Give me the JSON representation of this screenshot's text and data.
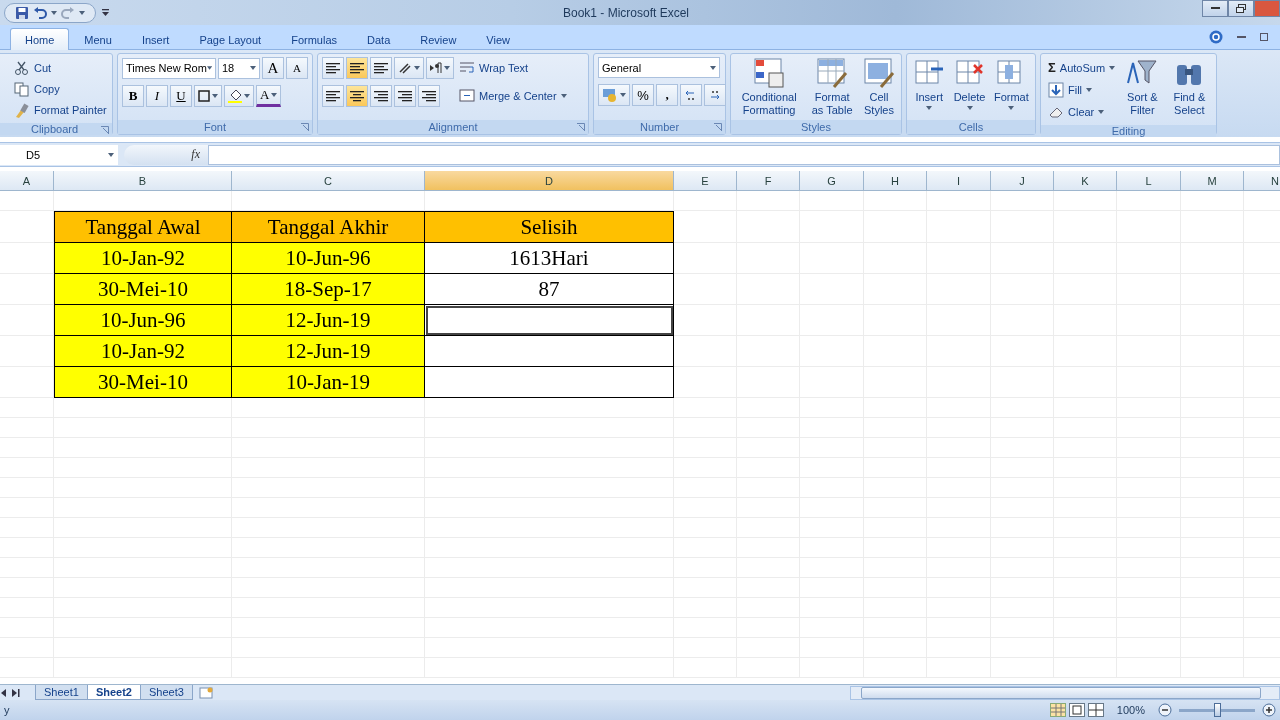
{
  "window": {
    "title": "Book1 - Microsoft Excel"
  },
  "tabs": [
    {
      "label": "Home",
      "selected": true
    },
    {
      "label": "Menu",
      "selected": false
    },
    {
      "label": "Insert",
      "selected": false
    },
    {
      "label": "Page Layout",
      "selected": false
    },
    {
      "label": "Formulas",
      "selected": false
    },
    {
      "label": "Data",
      "selected": false
    },
    {
      "label": "Review",
      "selected": false
    },
    {
      "label": "View",
      "selected": false
    }
  ],
  "ribbon": {
    "clipboard": {
      "items": [
        "Cut",
        "Copy",
        "Format Painter"
      ],
      "label": "Clipboard"
    },
    "font": {
      "font_name": "Times New Rom",
      "font_size": "18",
      "grow": "A",
      "shrink": "A",
      "bold": "B",
      "italic": "I",
      "underline": "U",
      "font_color": "A",
      "label": "Font"
    },
    "alignment": {
      "wrap": "Wrap Text",
      "merge": "Merge & Center",
      "label": "Alignment"
    },
    "number": {
      "format": "General",
      "percent": "%",
      "comma": ",",
      "label": "Number"
    },
    "styles": {
      "items": [
        "Conditional Formatting",
        "Format as Table",
        "Cell Styles"
      ],
      "label": "Styles"
    },
    "cells": {
      "items": [
        "Insert",
        "Delete",
        "Format"
      ],
      "label": "Cells"
    },
    "editing": {
      "sigma": "Σ",
      "autosum": "AutoSum",
      "fill": "Fill",
      "clear": "Clear",
      "big": [
        "Sort & Filter",
        "Find & Select"
      ],
      "label": "Editing"
    }
  },
  "formula_bar": {
    "name_box": "D5",
    "function_label": "fx"
  },
  "columns": [
    {
      "label": "A",
      "selected": false
    },
    {
      "label": "B",
      "selected": false
    },
    {
      "label": "C",
      "selected": false
    },
    {
      "label": "D",
      "selected": true
    },
    {
      "label": "E",
      "selected": false
    },
    {
      "label": "F",
      "selected": false
    },
    {
      "label": "G",
      "selected": false
    },
    {
      "label": "H",
      "selected": false
    },
    {
      "label": "I",
      "selected": false
    },
    {
      "label": "J",
      "selected": false
    },
    {
      "label": "K",
      "selected": false
    },
    {
      "label": "L",
      "selected": false
    },
    {
      "label": "M",
      "selected": false
    },
    {
      "label": "N",
      "selected": false
    }
  ],
  "table": {
    "header": [
      {
        "text": "Tanggal Awal",
        "color": "#ffc000"
      },
      {
        "text": "Tanggal Akhir",
        "color": "#ffc000"
      },
      {
        "text": "Selisih",
        "color": "#ffc000"
      }
    ],
    "rows": [
      [
        {
          "text": "10-Jan-92",
          "color": "#ffff00",
          "selected": false
        },
        {
          "text": "10-Jun-96",
          "color": "#ffff00",
          "selected": false
        },
        {
          "text": "1613Hari",
          "color": "#ffffff",
          "selected": false
        }
      ],
      [
        {
          "text": "30-Mei-10",
          "color": "#ffff00",
          "selected": false
        },
        {
          "text": "18-Sep-17",
          "color": "#ffff00",
          "selected": false
        },
        {
          "text": "87",
          "color": "#ffffff",
          "selected": false
        }
      ],
      [
        {
          "text": "10-Jun-96",
          "color": "#ffff00",
          "selected": false
        },
        {
          "text": "12-Jun-19",
          "color": "#ffff00",
          "selected": false
        },
        {
          "color": "#ffffff",
          "selected": true
        }
      ],
      [
        {
          "text": "10-Jan-92",
          "color": "#ffff00",
          "selected": false
        },
        {
          "text": "12-Jun-19",
          "color": "#ffff00",
          "selected": false
        },
        {
          "color": "#ffffff",
          "selected": false
        }
      ],
      [
        {
          "text": "30-Mei-10",
          "color": "#ffff00",
          "selected": false
        },
        {
          "text": "10-Jan-19",
          "color": "#ffff00",
          "selected": false
        },
        {
          "color": "#ffffff",
          "selected": false
        }
      ]
    ]
  },
  "sheets": [
    {
      "label": "Sheet1",
      "selected": false
    },
    {
      "label": "Sheet2",
      "selected": true
    },
    {
      "label": "Sheet3",
      "selected": false
    }
  ],
  "status_bar": {
    "text": "y",
    "zoom": "100%",
    "zoom_slider": {
      "level": 0.5
    }
  }
}
